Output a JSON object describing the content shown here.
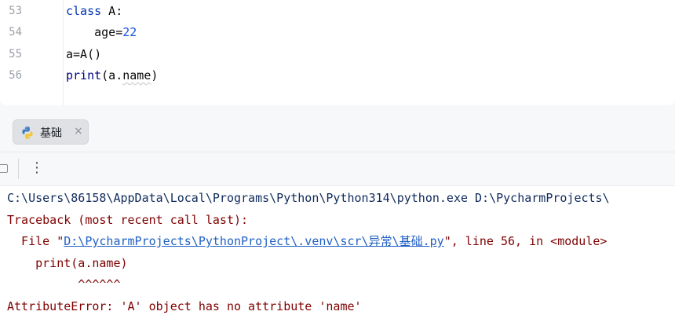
{
  "editor": {
    "line_numbers": [
      "53",
      "54",
      "55",
      "56"
    ],
    "lines": [
      {
        "kw": "class",
        "rest": " A:"
      },
      {
        "indent": "    ",
        "name": "age",
        "eq": "=",
        "num": "22"
      },
      {
        "text": "a=A()"
      },
      {
        "builtin": "print",
        "open": "(a.",
        "attr": "name",
        "close": ")"
      }
    ]
  },
  "run": {
    "tab_label": "基础",
    "tab_close": "×",
    "more": "⋮"
  },
  "console": {
    "command": "C:\\Users\\86158\\AppData\\Local\\Programs\\Python\\Python314\\python.exe D:\\PycharmProjects\\",
    "traceback_header": "Traceback (most recent call last):",
    "file_prefix": "  File \"",
    "file_link": "D:\\PycharmProjects\\PythonProject\\.venv\\scr\\异常\\基础.py",
    "file_suffix": "\", line 56, in <module>",
    "code_line": "    print(a.name)",
    "carets": "          ^^^^^^",
    "error": "AttributeError: 'A' object has no attribute 'name'"
  },
  "colors": {
    "keyword": "#0033b3",
    "number": "#1750eb",
    "error_text": "#7f0000",
    "link": "#2160c4",
    "command_text": "#0f2a5c"
  }
}
